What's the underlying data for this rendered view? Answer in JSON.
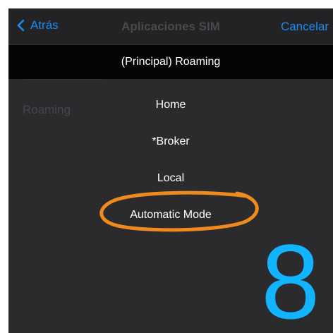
{
  "navbar": {
    "back_label": "Atrás",
    "title": "Aplicaciones SIM",
    "cancel_label": "Cancelar"
  },
  "background_list": {
    "row_label": "Roaming"
  },
  "picker": {
    "header": "(Principal) Roaming",
    "options": [
      "Home",
      "*Broker",
      "Local",
      "Automatic Mode"
    ],
    "highlighted_option": "Automatic Mode"
  },
  "annotation": {
    "step_number": "8",
    "circle_color": "#f08a1c",
    "number_color": "#12b4ff"
  },
  "colors": {
    "accent": "#1b8cf5"
  }
}
